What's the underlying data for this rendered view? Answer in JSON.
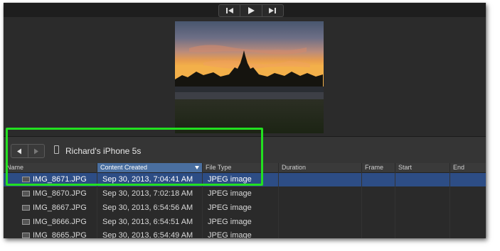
{
  "browser": {
    "device_name": "Richard's iPhone 5s"
  },
  "table": {
    "columns": {
      "name": "Name",
      "content_created": "Content Created",
      "file_type": "File Type",
      "duration": "Duration",
      "frame": "Frame",
      "start": "Start",
      "end": "End"
    },
    "rows": [
      {
        "name": "IMG_8671.JPG",
        "created": "Sep 30, 2013, 7:04:41 AM",
        "type": "JPEG image"
      },
      {
        "name": "IMG_8670.JPG",
        "created": "Sep 30, 2013, 7:02:18 AM",
        "type": "JPEG image"
      },
      {
        "name": "IMG_8667.JPG",
        "created": "Sep 30, 2013, 6:54:56 AM",
        "type": "JPEG image"
      },
      {
        "name": "IMG_8666.JPG",
        "created": "Sep 30, 2013, 6:54:51 AM",
        "type": "JPEG image"
      },
      {
        "name": "IMG_8665.JPG",
        "created": "Sep 30, 2013, 6:54:49 AM",
        "type": "JPEG image"
      }
    ],
    "selected_row": 0
  },
  "colors": {
    "highlight": "#22e020",
    "selection": "#2d4d85",
    "sorted_header": "#4a6fa0"
  },
  "icons": {
    "transport": [
      "skip-back-icon",
      "play-icon",
      "skip-forward-icon"
    ],
    "navigation": [
      "back-arrow-icon",
      "forward-arrow-icon"
    ],
    "device": "iphone-icon",
    "file": "image-file-icon"
  }
}
